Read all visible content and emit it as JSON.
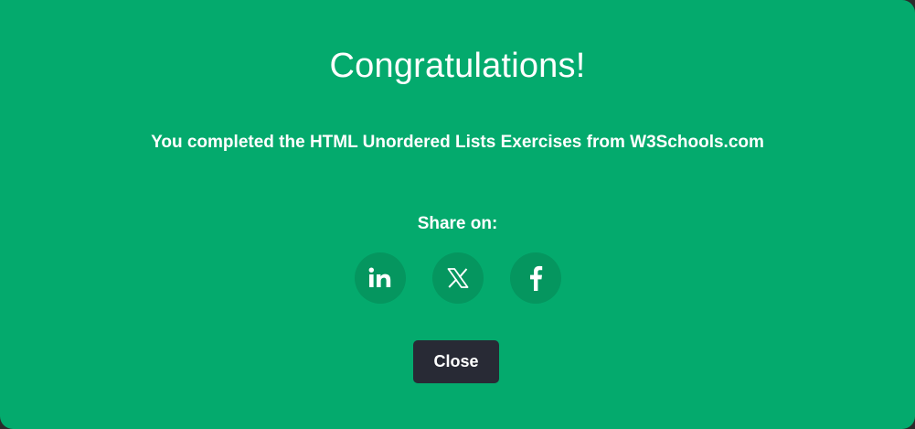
{
  "modal": {
    "title": "Congratulations!",
    "message": "You completed the HTML Unordered Lists Exercises from W3Schools.com",
    "share_label": "Share on:",
    "share_buttons": [
      {
        "icon": "linkedin-icon"
      },
      {
        "icon": "x-icon"
      },
      {
        "icon": "facebook-icon"
      }
    ],
    "close_label": "Close"
  },
  "colors": {
    "background": "#04aa6d",
    "share_button": "#05965f",
    "close_button": "#282a35",
    "text": "#ffffff"
  }
}
